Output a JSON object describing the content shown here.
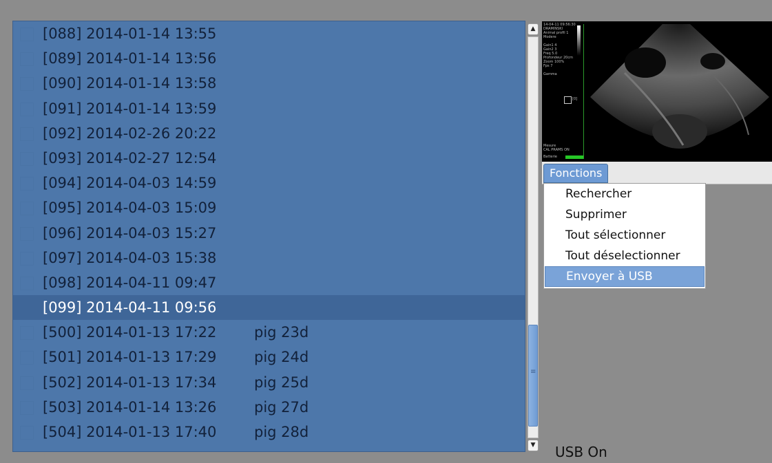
{
  "exam_list": {
    "rows": [
      {
        "id": "[088] 2014-01-14 13:55",
        "note": ""
      },
      {
        "id": "[089] 2014-01-14 13:56",
        "note": ""
      },
      {
        "id": "[090] 2014-01-14 13:58",
        "note": ""
      },
      {
        "id": "[091] 2014-01-14 13:59",
        "note": ""
      },
      {
        "id": "[092] 2014-02-26 20:22",
        "note": ""
      },
      {
        "id": "[093] 2014-02-27 12:54",
        "note": ""
      },
      {
        "id": "[094] 2014-04-03 14:59",
        "note": ""
      },
      {
        "id": "[095] 2014-04-03 15:09",
        "note": ""
      },
      {
        "id": "[096] 2014-04-03 15:27",
        "note": ""
      },
      {
        "id": "[097] 2014-04-03 15:38",
        "note": ""
      },
      {
        "id": "[098] 2014-04-11 09:47",
        "note": ""
      },
      {
        "id": "[099] 2014-04-11 09:56",
        "note": "",
        "selected": true
      },
      {
        "id": "[500] 2014-01-13 17:22",
        "note": "pig 23d"
      },
      {
        "id": "[501] 2014-01-13 17:29",
        "note": "pig 24d"
      },
      {
        "id": "[502] 2014-01-13 17:34",
        "note": "pig 25d"
      },
      {
        "id": "[503] 2014-01-14 13:26",
        "note": "pig 27d"
      },
      {
        "id": "[504] 2014-01-13 17:40",
        "note": "pig 28d"
      }
    ]
  },
  "scrollbar": {
    "up_icon": "▲",
    "down_icon": "▼",
    "grip_icon": "≡"
  },
  "preview": {
    "overlay_lines": [
      "14-04-11 09:56:30",
      "DRAMINSKI",
      "Animal profil 1",
      "Modere",
      "Gain1   4",
      "Gain2   3",
      "Freq    5.0",
      "Profondeur 20cm",
      "Zoom   100%",
      "Fps    7",
      "Gamma"
    ],
    "gamma_value": "[0]",
    "bottom_lines": [
      "Mesure",
      "CAL PRAMS ON"
    ],
    "battery_label": "Batterie"
  },
  "menu": {
    "title": "Fonctions",
    "items": [
      {
        "label": "Rechercher"
      },
      {
        "label": "Supprimer"
      },
      {
        "label": "Tout sélectionner"
      },
      {
        "label": "Tout déselectionner"
      },
      {
        "label": "Envoyer à USB",
        "highlighted": true
      }
    ]
  },
  "status": {
    "usb": "USB On"
  },
  "colors": {
    "list_bg": "#4d77aa",
    "selected_row": "#3f6698",
    "menu_accent": "#7aa3d8",
    "window_bg": "#8c8c8c"
  }
}
